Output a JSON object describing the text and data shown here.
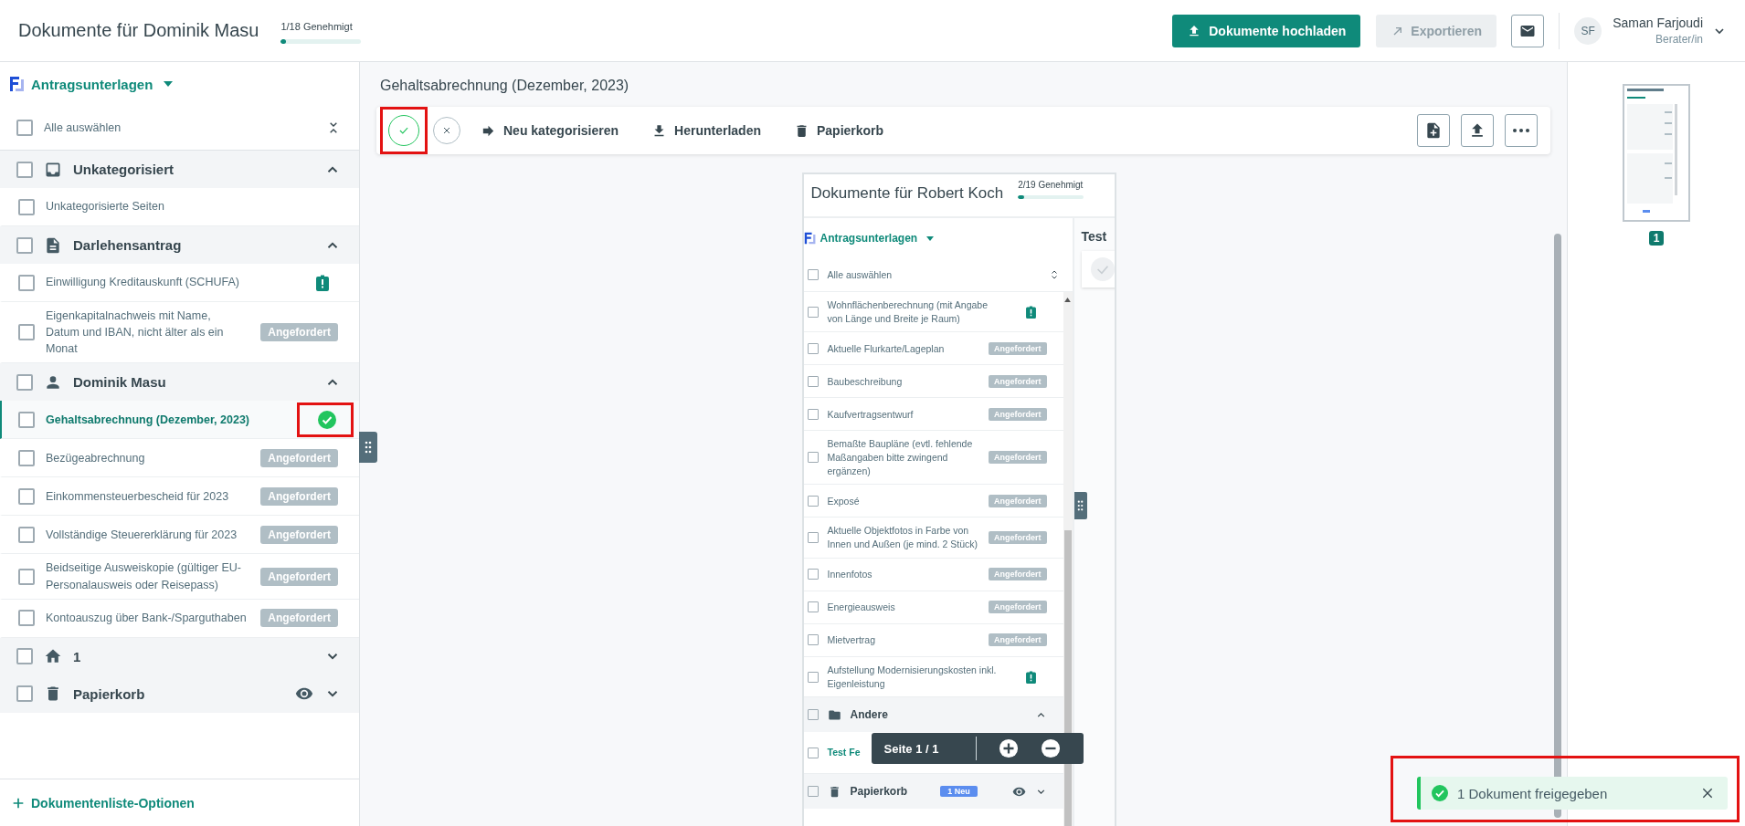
{
  "header": {
    "title": "Dokumente für Dominik Masu",
    "progress": {
      "label": "1/18 Genehmigt",
      "level": 0.06
    },
    "upload_button": "Dokumente hochladen",
    "export_button": {
      "label": "Exportieren",
      "disabled": true
    },
    "user": {
      "initials": "SF",
      "name": "Saman Farjoudi",
      "role": "Berater/in"
    }
  },
  "sidebar": {
    "dropdown": "Antragsunterlagen",
    "select_all": {
      "label": "Alle auswählen",
      "checked": false
    },
    "groups": [
      {
        "kind": "inbox",
        "title": "Unkategorisiert",
        "expanded": true,
        "items": [
          {
            "label": "Unkategorisierte Seiten",
            "kind": "plain",
            "selected": false,
            "highlighted": false
          }
        ]
      },
      {
        "kind": "document",
        "title": "Darlehensantrag",
        "expanded": true,
        "items": [
          {
            "label": "Einwilligung Kreditauskunft (SCHUFA)",
            "kind": "alert",
            "selected": false,
            "highlighted": false
          },
          {
            "label": "Eigenkapitalnachweis mit Name, Datum und IBAN, nicht älter als ein Monat",
            "kind": "requested",
            "badge": "Angefordert",
            "selected": false,
            "highlighted": false
          }
        ]
      },
      {
        "kind": "person",
        "title": "Dominik Masu",
        "expanded": true,
        "items": [
          {
            "label": "Gehaltsabrechnung (Dezember, 2023)",
            "kind": "approved",
            "selected": true,
            "highlighted": true
          },
          {
            "label": "Bezügeabrechnung",
            "kind": "requested",
            "badge": "Angefordert",
            "selected": false,
            "highlighted": false
          },
          {
            "label": "Einkommensteuerbescheid für 2023",
            "kind": "requested",
            "badge": "Angefordert",
            "selected": false,
            "highlighted": false
          },
          {
            "label": "Vollständige Steuererklärung für 2023",
            "kind": "requested",
            "badge": "Angefordert",
            "selected": false,
            "highlighted": false
          },
          {
            "label": "Beidseitige Ausweiskopie (gültiger EU-Personalausweis oder Reisepass)",
            "kind": "requested",
            "badge": "Angefordert",
            "selected": false,
            "highlighted": false
          },
          {
            "label": "Kontoauszug über Bank-/Sparguthaben",
            "kind": "requested",
            "badge": "Angefordert",
            "selected": false,
            "highlighted": false
          }
        ]
      },
      {
        "kind": "home",
        "title": "1",
        "expanded": false
      },
      {
        "kind": "trash",
        "title": "Papierkorb",
        "expanded": false
      }
    ],
    "footer": "Dokumentenliste-Optionen"
  },
  "viewer": {
    "title": "Gehaltsabrechnung (Dezember, 2023)",
    "approve_highlighted": true,
    "actions": [
      {
        "kind": "recategorize",
        "label": "Neu kategorisieren"
      },
      {
        "kind": "download",
        "label": "Herunterladen"
      },
      {
        "kind": "trash",
        "label": "Papierkorb"
      }
    ],
    "document": {
      "title": "Dokumente für Robert Koch",
      "progress": {
        "label": "2/19 Genehmigt",
        "level": 0.1
      },
      "dropdown": "Antragsunterlagen",
      "select_all": {
        "label": "Alle auswählen",
        "checked": false
      },
      "items": [
        {
          "label": "Wohnflächenberechnung (mit Angabe von Länge und Breite je Raum)",
          "kind": "alert",
          "selected": false
        },
        {
          "label": "Aktuelle Flurkarte/Lageplan",
          "kind": "requested",
          "badge": "Angefordert",
          "selected": false
        },
        {
          "label": "Baubeschreibung",
          "kind": "requested",
          "badge": "Angefordert",
          "selected": false
        },
        {
          "label": "Kaufvertragsentwurf",
          "kind": "requested",
          "badge": "Angefordert",
          "selected": false
        },
        {
          "label": "Bemaßte Baupläne (evtl. fehlende Maßangaben bitte zwingend ergänzen)",
          "kind": "requested",
          "badge": "Angefordert",
          "selected": false
        },
        {
          "label": "Exposé",
          "kind": "requested",
          "badge": "Angefordert",
          "selected": false
        },
        {
          "label": "Aktuelle Objektfotos in Farbe von Innen und Außen (je mind. 2 Stück)",
          "kind": "requested",
          "badge": "Angefordert",
          "selected": false
        },
        {
          "label": "Innenfotos",
          "kind": "requested",
          "badge": "Angefordert",
          "selected": false
        },
        {
          "label": "Energieausweis",
          "kind": "requested",
          "badge": "Angefordert",
          "selected": false
        },
        {
          "label": "Mietvertrag",
          "kind": "requested",
          "badge": "Angefordert",
          "selected": false
        },
        {
          "label": "Aufstellung Modernisierungskosten inkl. Eigenleistung",
          "kind": "alert",
          "selected": false
        }
      ],
      "groups": [
        {
          "kind": "folder",
          "title": "Andere",
          "expanded": true,
          "items": [
            {
              "label": "Test Fe",
              "selected": true,
              "checked": false
            }
          ]
        },
        {
          "kind": "trash",
          "title": "Papierkorb",
          "expanded": false,
          "badge": "1 Neu"
        }
      ],
      "side_title": "Test"
    },
    "page_bar": {
      "label": "Seite 1 / 1"
    }
  },
  "thumbnails": [
    {
      "page": "1",
      "selected": true
    }
  ],
  "toast": {
    "message": "1 Dokument freigegeben",
    "highlighted": true
  }
}
